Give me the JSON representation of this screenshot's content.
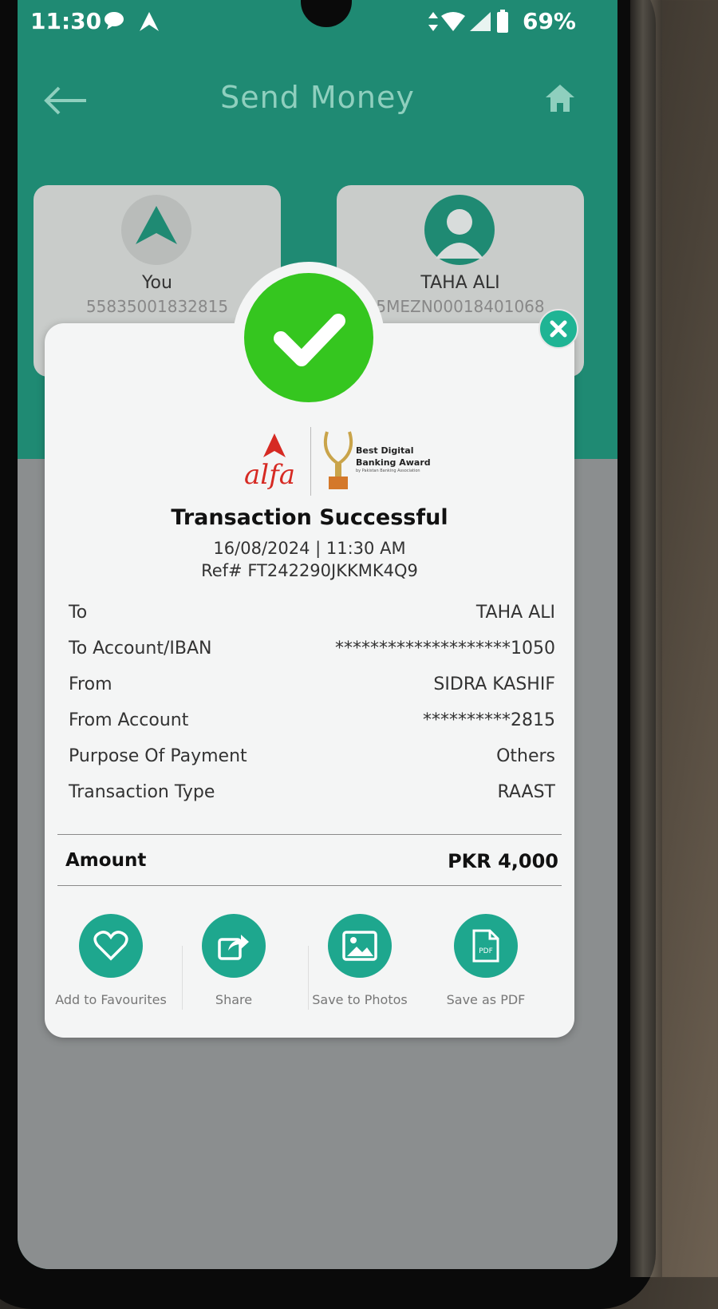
{
  "status_bar": {
    "time": "11:30",
    "battery": "69%"
  },
  "header": {
    "title": "Send Money"
  },
  "sender_card": {
    "name": "You",
    "account": "55835001832815"
  },
  "recipient_card": {
    "name": "TAHA ALI",
    "account": "5MEZN00018401068"
  },
  "brand": {
    "logo_text": "alfa",
    "award_line1": "Best Digital",
    "award_line2": "Banking Award",
    "award_sub": "by Pakistan Banking Association"
  },
  "transaction": {
    "title": "Transaction Successful",
    "datetime": "16/08/2024 | 11:30 AM",
    "ref": "Ref# FT242290JKKMK4Q9",
    "details": [
      {
        "label": "To",
        "value": "TAHA ALI"
      },
      {
        "label": "To Account/IBAN",
        "value": "********************1050"
      },
      {
        "label": "From",
        "value": "SIDRA KASHIF"
      },
      {
        "label": "From Account",
        "value": "**********2815"
      },
      {
        "label": "Purpose Of Payment",
        "value": "Others"
      },
      {
        "label": "Transaction Type",
        "value": "RAAST"
      }
    ],
    "amount_label": "Amount",
    "amount_value": "PKR 4,000"
  },
  "actions": [
    {
      "label": "Add to Favourites",
      "icon": "heart-icon"
    },
    {
      "label": "Share",
      "icon": "share-icon"
    },
    {
      "label": "Save to Photos",
      "icon": "photo-icon"
    },
    {
      "label": "Save as PDF",
      "icon": "pdf-icon"
    }
  ],
  "colors": {
    "primary": "#1f8a73",
    "accent": "#1ea78e",
    "success": "#35c61f",
    "brand_red": "#d62a23"
  }
}
